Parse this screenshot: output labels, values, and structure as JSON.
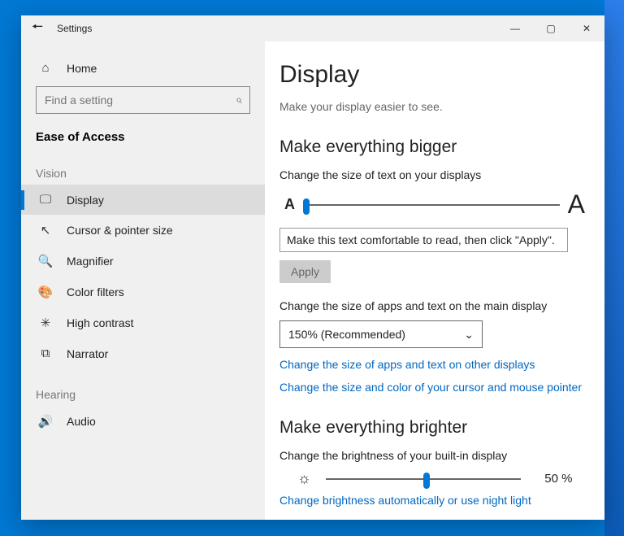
{
  "window": {
    "title": "Settings",
    "buttons": {
      "minimize": "—",
      "maximize": "▢",
      "close": "✕"
    }
  },
  "sidebar": {
    "home_label": "Home",
    "search_placeholder": "Find a setting",
    "category": "Ease of Access",
    "groups": [
      {
        "label": "Vision",
        "items": [
          {
            "key": "display",
            "label": "Display",
            "icon": "🖵",
            "selected": true
          },
          {
            "key": "cursor",
            "label": "Cursor & pointer size",
            "icon": "↖"
          },
          {
            "key": "magnifier",
            "label": "Magnifier",
            "icon": "🔍"
          },
          {
            "key": "colorfilters",
            "label": "Color filters",
            "icon": "🎨"
          },
          {
            "key": "highcontrast",
            "label": "High contrast",
            "icon": "✳"
          },
          {
            "key": "narrator",
            "label": "Narrator",
            "icon": "⧉"
          }
        ]
      },
      {
        "label": "Hearing",
        "items": [
          {
            "key": "audio",
            "label": "Audio",
            "icon": "🔊"
          }
        ]
      }
    ]
  },
  "main": {
    "title": "Display",
    "subtitle": "Make your display easier to see.",
    "section_bigger": {
      "heading": "Make everything bigger",
      "text_size_label": "Change the size of text on your displays",
      "sample_text": "Make this text comfortable to read, then click \"Apply\".",
      "apply_label": "Apply",
      "app_size_label": "Change the size of apps and text on the main display",
      "dropdown_value": "150% (Recommended)",
      "link_other_displays": "Change the size of apps and text on other displays",
      "link_cursor": "Change the size and color of your cursor and mouse pointer"
    },
    "section_brighter": {
      "heading": "Make everything brighter",
      "brightness_label": "Change the brightness of your built-in display",
      "brightness_value": "50 %",
      "link_nightlight": "Change brightness automatically or use night light"
    }
  }
}
